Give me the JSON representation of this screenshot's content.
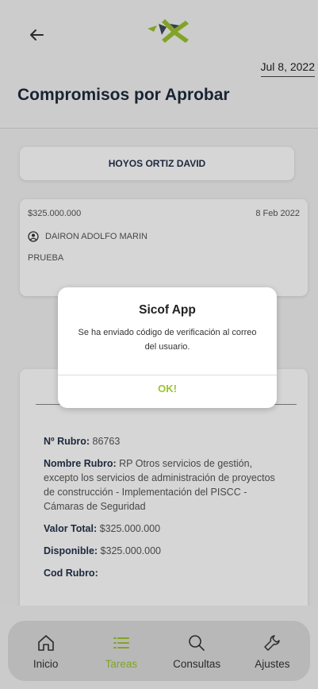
{
  "header": {
    "date": "Jul 8, 2022",
    "title": "Compromisos por Aprobar"
  },
  "client": {
    "name": "HOYOS ORTIZ DAVID"
  },
  "item": {
    "amount": "$325.000.000",
    "date": "8 Feb 2022",
    "person": "DAIRON ADOLFO MARIN",
    "label": "PRUEBA"
  },
  "detail": {
    "rubro_label": "Nº Rubro:",
    "rubro_value": "86763",
    "nombre_label": "Nombre Rubro:",
    "nombre_value": "RP Otros servicios de gestión, excepto los servicios de administración de proyectos de construcción - Implementación del PISCC - Cámaras de Seguridad",
    "valor_label": "Valor Total:",
    "valor_value": "$325.000.000",
    "disp_label": "Disponible:",
    "disp_value": "$325.000.000",
    "cod_label": "Cod Rubro:"
  },
  "dialog": {
    "title": "Sicof App",
    "message": "Se ha enviado código de verificación al correo del usuario.",
    "ok": "OK!"
  },
  "tabs": [
    {
      "label": "Inicio",
      "icon": "home-icon"
    },
    {
      "label": "Tareas",
      "icon": "list-icon"
    },
    {
      "label": "Consultas",
      "icon": "search-icon"
    },
    {
      "label": "Ajustes",
      "icon": "wrench-icon"
    }
  ],
  "colors": {
    "accent": "#9bc32e",
    "title": "#1e2a3c"
  }
}
